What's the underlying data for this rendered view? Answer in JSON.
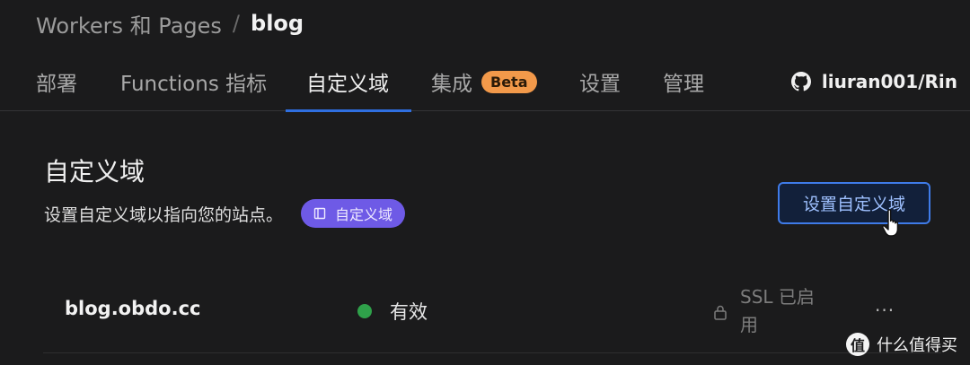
{
  "breadcrumb": {
    "parent": "Workers 和 Pages",
    "separator": "/",
    "current": "blog"
  },
  "tabs": [
    {
      "label": "部署"
    },
    {
      "label": "Functions 指标"
    },
    {
      "label": "自定义域",
      "active": true
    },
    {
      "label": "集成",
      "badge": "Beta"
    },
    {
      "label": "设置"
    },
    {
      "label": "管理"
    }
  ],
  "repo": {
    "icon": "github-icon",
    "label": "liuran001/Rin"
  },
  "section": {
    "title": "自定义域",
    "description": "设置自定义域以指向您的站点。",
    "docs_pill": {
      "icon": "book-icon",
      "label": "自定义域"
    },
    "primary_button": "设置自定义域"
  },
  "domains": [
    {
      "domain": "blog.obdo.cc",
      "status": "有效",
      "status_color": "#2fa14a",
      "ssl": "SSL 已启用",
      "more": "..."
    }
  ],
  "watermark": {
    "logo_glyph": "值",
    "text": "什么值得买"
  },
  "colors": {
    "background": "#1b1b1c",
    "accent": "#3f7be8",
    "tab_underline": "#2f6fe0",
    "badge_beta": "#f2994a",
    "docs_pill": "#6e5ae6"
  }
}
